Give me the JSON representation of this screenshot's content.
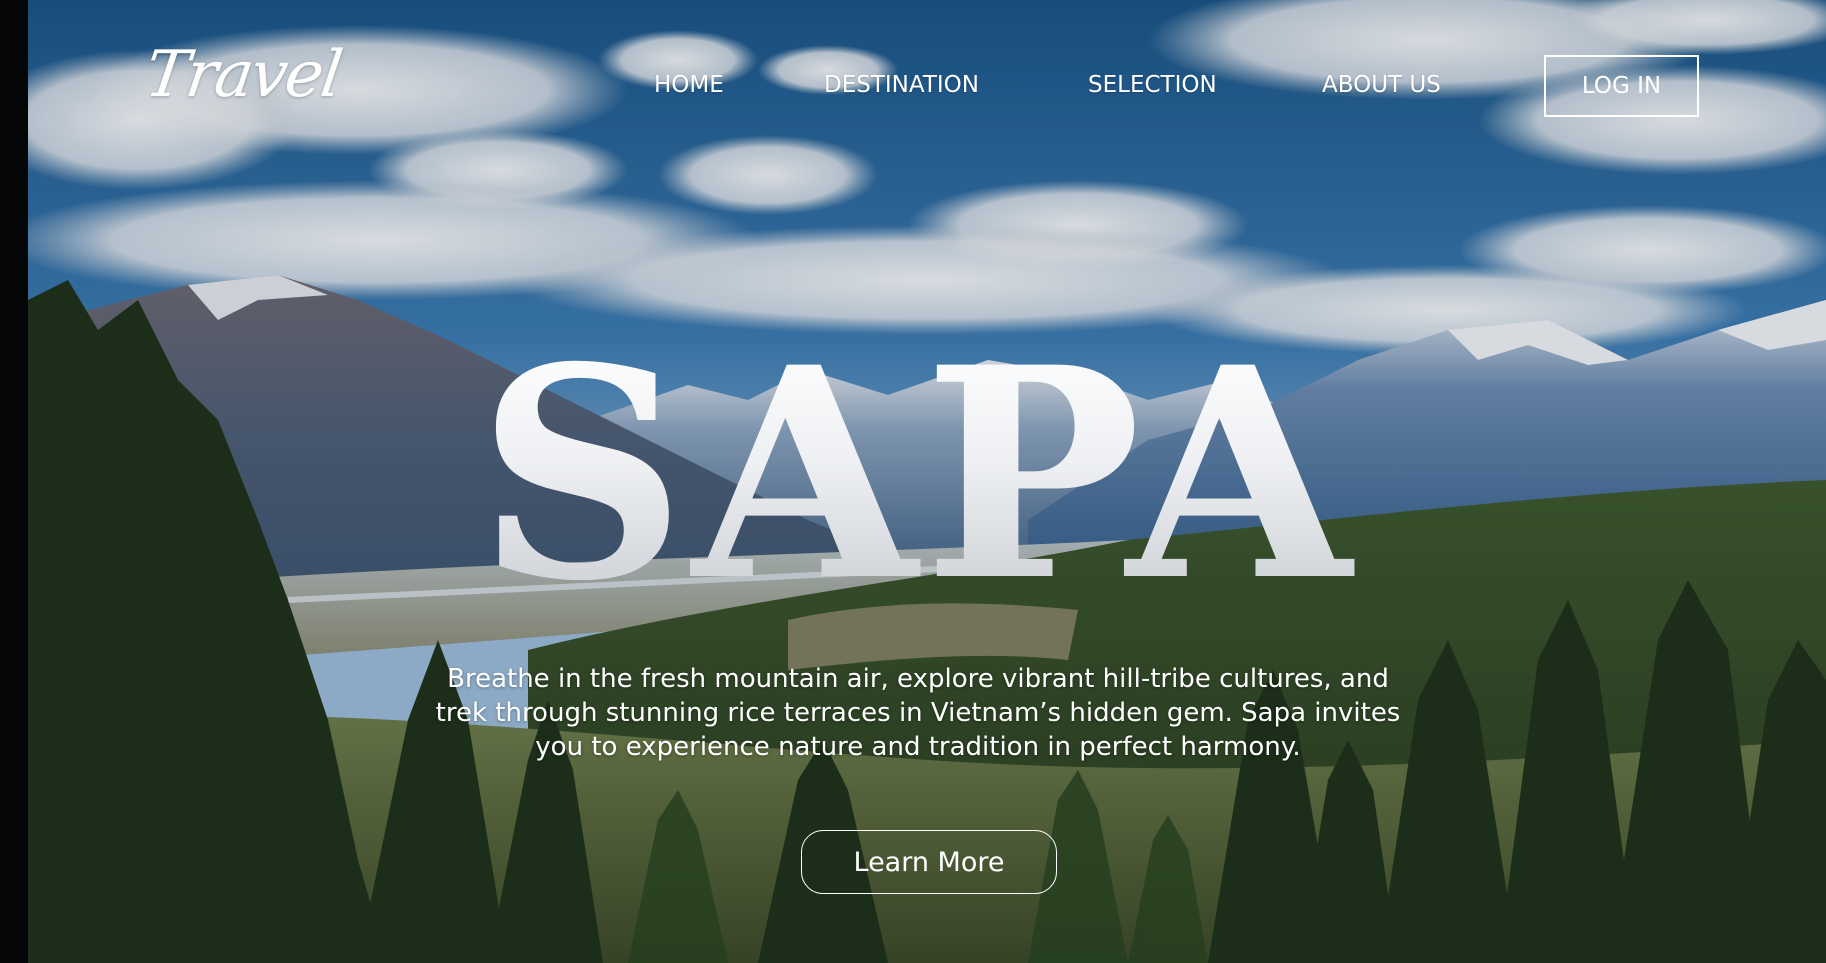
{
  "brand": {
    "logo_text": "Travel"
  },
  "nav": {
    "items": [
      {
        "label": "HOME"
      },
      {
        "label": "DESTINATION"
      },
      {
        "label": "SELECTION"
      },
      {
        "label": "ABOUT US"
      }
    ],
    "login_label": "LOG IN"
  },
  "hero": {
    "title": "SAPA",
    "tagline": "Breathe in the fresh mountain air, explore vibrant hill-tribe cultures, and trek through stunning rice terraces in Vietnam’s hidden gem. Sapa invites you to experience nature and tradition in perfect harmony.",
    "cta_label": "Learn More"
  },
  "colors": {
    "text": "#ffffff",
    "sky_top": "#1f5f94",
    "sky_bottom": "#6fa3cf",
    "forest": "#2d4a24"
  }
}
